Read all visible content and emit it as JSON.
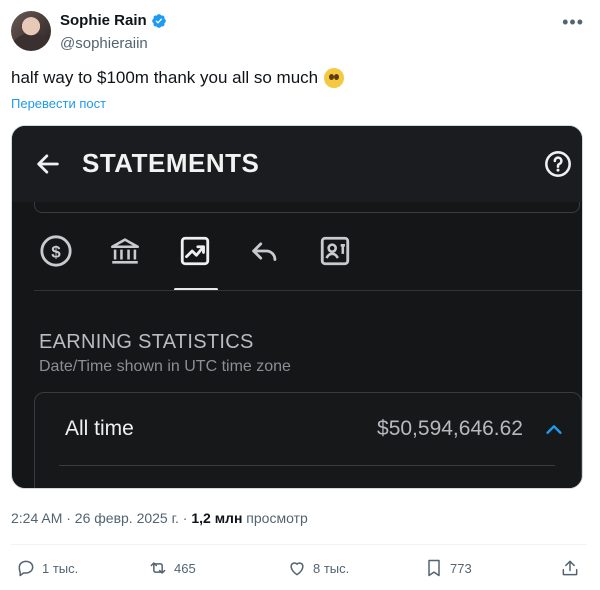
{
  "author": {
    "name": "Sophie Rain",
    "handle": "@sophieraiin"
  },
  "tweet": {
    "text": "half way to $100m thank you all so much",
    "translate_label": "Перевести пост"
  },
  "media": {
    "title": "STATEMENTS",
    "tabs": [
      "dollar-icon",
      "bank-icon",
      "chart-icon",
      "undo-icon",
      "statement-icon"
    ],
    "active_tab": 2,
    "stats_title": "EARNING STATISTICS",
    "stats_subtitle": "Date/Time shown in UTC time zone",
    "alltime_label": "All time",
    "alltime_value": "$50,594,646.62"
  },
  "meta": {
    "time": "2:24 AM · 26 февр. 2025 г. · ",
    "views": "1,2 млн",
    "views_label": " просмотр"
  },
  "actions": {
    "replies": "1 тыс.",
    "reposts": "465",
    "likes": "8 тыс.",
    "bookmarks": "773"
  },
  "colors": {
    "link": "#1d9bf0",
    "muted": "#536471",
    "verified": "#1d9bf0"
  }
}
